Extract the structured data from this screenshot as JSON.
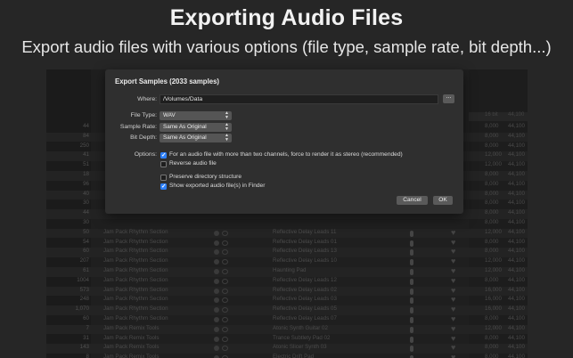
{
  "hero": {
    "title": "Exporting Audio Files",
    "subtitle": "Export audio files with various options (file type, sample rate, bit depth...)"
  },
  "dialog": {
    "title": "Export Samples (2033 samples)",
    "where_label": "Where:",
    "where_value": "/Volumes/Data",
    "browse_label": "...",
    "file_type_label": "File Type:",
    "file_type_value": "WAV",
    "sample_rate_label": "Sample Rate:",
    "sample_rate_value": "Same As Original",
    "bit_depth_label": "Bit Depth:",
    "bit_depth_value": "Same As Original",
    "options_label": "Options:",
    "options": [
      {
        "label": "For an audio file with more than two channels, force to render it as stereo (recommended)",
        "checked": true
      },
      {
        "label": "Reverse audio file",
        "checked": false
      },
      {
        "label": "Preserve directory structure",
        "checked": false
      },
      {
        "label": "Show exported audio file(s) in Finder",
        "checked": true
      }
    ],
    "cancel_label": "Cancel",
    "ok_label": "OK"
  },
  "background_table": {
    "header_right": [
      "16 bit",
      "44,100"
    ],
    "rows": [
      {
        "num": "44",
        "category": "",
        "name": "",
        "r1": "8,000",
        "r2": "44,100"
      },
      {
        "num": "84",
        "category": "",
        "name": "",
        "r1": "8,000",
        "r2": "44,100"
      },
      {
        "num": "250",
        "category": "",
        "name": "",
        "r1": "8,000",
        "r2": "44,100"
      },
      {
        "num": "41",
        "category": "",
        "name": "",
        "r1": "12,000",
        "r2": "44,100"
      },
      {
        "num": "51",
        "category": "",
        "name": "",
        "r1": "12,000",
        "r2": "44,100"
      },
      {
        "num": "18",
        "category": "",
        "name": "",
        "r1": "8,000",
        "r2": "44,100"
      },
      {
        "num": "96",
        "category": "",
        "name": "",
        "r1": "8,000",
        "r2": "44,100"
      },
      {
        "num": "40",
        "category": "",
        "name": "",
        "r1": "8,000",
        "r2": "44,100"
      },
      {
        "num": "30",
        "category": "",
        "name": "",
        "r1": "8,000",
        "r2": "44,100"
      },
      {
        "num": "44",
        "category": "",
        "name": "",
        "r1": "8,000",
        "r2": "44,100"
      },
      {
        "num": "30",
        "category": "",
        "name": "",
        "r1": "8,000",
        "r2": "44,100"
      },
      {
        "num": "50",
        "category": "Jam Pack Rhythm Section",
        "name": "Reflective Delay Leads 11",
        "r1": "12,000",
        "r2": "44,100"
      },
      {
        "num": "54",
        "category": "Jam Pack Rhythm Section",
        "name": "Reflective Delay Leads 01",
        "r1": "8,000",
        "r2": "44,100"
      },
      {
        "num": "60",
        "category": "Jam Pack Rhythm Section",
        "name": "Reflective Delay Leads 13",
        "r1": "8,000",
        "r2": "44,100"
      },
      {
        "num": "207",
        "category": "Jam Pack Rhythm Section",
        "name": "Reflective Delay Leads 10",
        "r1": "12,000",
        "r2": "44,100"
      },
      {
        "num": "61",
        "category": "Jam Pack Rhythm Section",
        "name": "Haunting Pad",
        "r1": "12,000",
        "r2": "44,100"
      },
      {
        "num": "1004",
        "category": "Jam Pack Rhythm Section",
        "name": "Reflective Delay Leads 12",
        "r1": "8,000",
        "r2": "44,100"
      },
      {
        "num": "573",
        "category": "Jam Pack Rhythm Section",
        "name": "Reflective Delay Leads 02",
        "r1": "16,000",
        "r2": "44,100"
      },
      {
        "num": "248",
        "category": "Jam Pack Rhythm Section",
        "name": "Reflective Delay Leads 03",
        "r1": "16,000",
        "r2": "44,100"
      },
      {
        "num": "1,070",
        "category": "Jam Pack Rhythm Section",
        "name": "Reflective Delay Leads 05",
        "r1": "16,000",
        "r2": "44,100"
      },
      {
        "num": "60",
        "category": "Jam Pack Rhythm Section",
        "name": "Reflective Delay Leads 07",
        "r1": "8,000",
        "r2": "44,100"
      },
      {
        "num": "7",
        "category": "Jam Pack Remix Tools",
        "name": "Atonic Synth Guitar 02",
        "r1": "12,000",
        "r2": "44,100"
      },
      {
        "num": "31",
        "category": "Jam Pack Remix Tools",
        "name": "Trance Subtlety Pad 02",
        "r1": "8,000",
        "r2": "44,100"
      },
      {
        "num": "143",
        "category": "Jam Pack Remix Tools",
        "name": "Atonic Slicer Synth 03",
        "r1": "8,000",
        "r2": "44,100"
      },
      {
        "num": "8",
        "category": "Jam Pack Remix Tools",
        "name": "Electric Drift Pad",
        "r1": "8,000",
        "r2": "44,100"
      },
      {
        "num": "285",
        "category": "Jam Pack Remix Tools",
        "name": "Trance Pad",
        "r1": "8,000",
        "r2": "44,100"
      }
    ]
  }
}
